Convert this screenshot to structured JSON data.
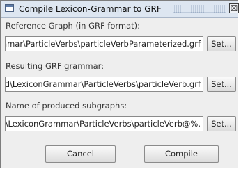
{
  "window": {
    "title": "Compile Lexicon-Grammar to GRF",
    "icon": "window-icon",
    "close_icon": "close-icon",
    "close_glyph": "☒"
  },
  "fields": [
    {
      "label": "Reference Graph (in GRF format):",
      "value": ".mmar\\ParticleVerbs\\particleVerbParameterized.grf",
      "button_label": "Set..."
    },
    {
      "label": "Resulting GRF grammar:",
      "value": "ted\\LexiconGrammar\\ParticleVerbs\\particleVerb.grf",
      "button_label": "Set..."
    },
    {
      "label": "Name of produced subgraphs:",
      "value": "ed\\LexiconGrammar\\ParticleVerbs\\particleVerb@%.",
      "button_label": "Set..."
    }
  ],
  "actions": {
    "cancel_label": "Cancel",
    "compile_label": "Compile"
  }
}
